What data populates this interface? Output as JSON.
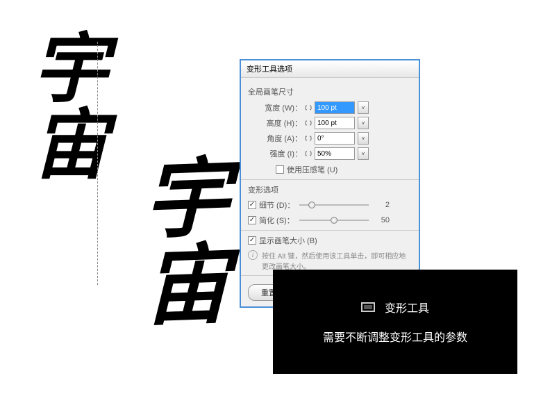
{
  "calligraphy": {
    "text_left": "宇宙",
    "text_right": "宇宙"
  },
  "dialog": {
    "title": "变形工具选项",
    "brush_section": "全局画笔尺寸",
    "width_label": "宽度 (W)：",
    "width_value": "100 pt",
    "height_label": "高度 (H)：",
    "height_value": "100 pt",
    "angle_label": "角度 (A)：",
    "angle_value": "0°",
    "intensity_label": "强度 (I)：",
    "intensity_value": "50%",
    "pressure_label": "使用压感笔 (U)",
    "warp_section": "变形选项",
    "detail_label": "细节 (D)：",
    "detail_value": "2",
    "simplify_label": "简化 (S)：",
    "simplify_value": "50",
    "show_size_label": "显示画笔大小 (B)",
    "info_text": "按住 Alt 键，然后使用该工具单击，即可相应地更改画笔大小。",
    "reset_label": "重置"
  },
  "tooltip": {
    "title": "变形工具",
    "desc": "需要不断调整变形工具的参数"
  }
}
